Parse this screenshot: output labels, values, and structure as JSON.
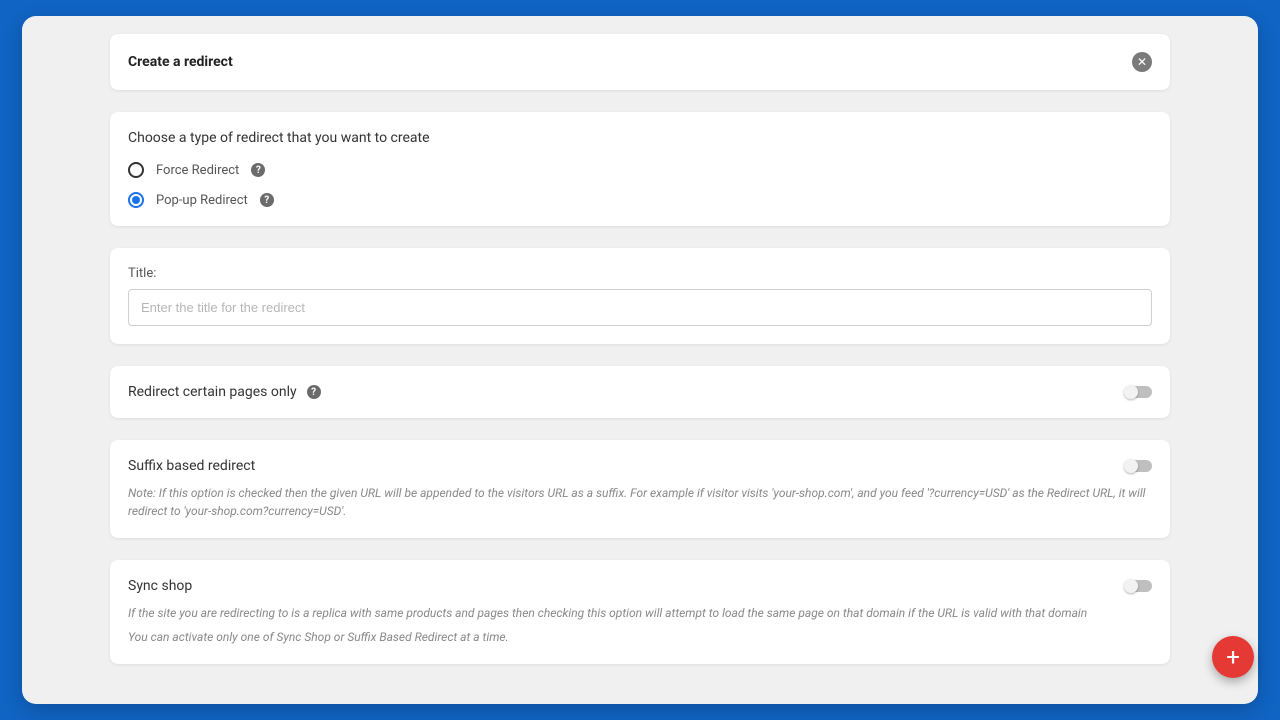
{
  "header": {
    "title": "Create a redirect"
  },
  "typeSection": {
    "label": "Choose a type of redirect that you want to create",
    "options": [
      {
        "label": "Force Redirect",
        "selected": false
      },
      {
        "label": "Pop-up Redirect",
        "selected": true
      }
    ]
  },
  "titleField": {
    "label": "Title:",
    "placeholder": "Enter the title for the redirect",
    "value": ""
  },
  "certainPages": {
    "label": "Redirect certain pages only",
    "enabled": false
  },
  "suffix": {
    "label": "Suffix based redirect",
    "enabled": false,
    "note": "Note: If this option is checked then the given URL will be appended to the visitors URL as a suffix. For example if visitor visits 'your-shop.com', and you feed '?currency=USD' as the Redirect URL, it will redirect to 'your-shop.com?currency=USD'."
  },
  "syncShop": {
    "label": "Sync shop",
    "enabled": false,
    "note1": "If the site you are redirecting to is a replica with same products and pages then checking this option will attempt to load the same page on that domain if the URL is valid with that domain",
    "note2": "You can activate only one of Sync Shop or Suffix Based Redirect at a time."
  },
  "icons": {
    "help": "?",
    "close": "✕",
    "plus": "+"
  }
}
